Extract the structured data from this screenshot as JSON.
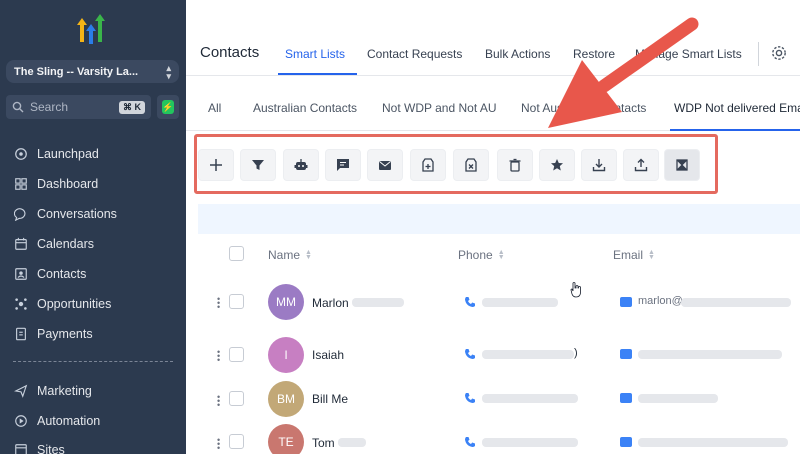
{
  "sidebar": {
    "account_name": "The Sling -- Varsity La...",
    "search_placeholder": "Search",
    "search_shortcut": "⌘ K",
    "items": [
      {
        "label": "Launchpad",
        "icon": "launchpad-icon"
      },
      {
        "label": "Dashboard",
        "icon": "dashboard-icon"
      },
      {
        "label": "Conversations",
        "icon": "chat-icon"
      },
      {
        "label": "Calendars",
        "icon": "calendar-icon"
      },
      {
        "label": "Contacts",
        "icon": "contacts-icon"
      },
      {
        "label": "Opportunities",
        "icon": "opportunities-icon"
      },
      {
        "label": "Payments",
        "icon": "payments-icon"
      },
      {
        "label": "Marketing",
        "icon": "send-icon"
      },
      {
        "label": "Automation",
        "icon": "automation-icon"
      },
      {
        "label": "Sites",
        "icon": "sites-icon"
      }
    ]
  },
  "header": {
    "title": "Contacts",
    "tabs": [
      "Smart Lists",
      "Contact Requests",
      "Bulk Actions",
      "Restore",
      "Manage Smart Lists"
    ],
    "active_tab": "Smart Lists"
  },
  "smart_lists": {
    "tabs": [
      "All",
      "Australian Contacts",
      "Not WDP and Not AU",
      "Not Australian Contacts",
      "WDP Not delivered Ema"
    ],
    "active_tab": "WDP Not delivered Ema"
  },
  "toolbar": {
    "buttons": [
      "add-icon",
      "filter-icon",
      "robot-icon",
      "sms-icon",
      "email-icon",
      "add-tag-icon",
      "remove-tag-icon",
      "delete-icon",
      "star-icon",
      "import-icon",
      "export-icon",
      "merge-icon"
    ]
  },
  "table": {
    "columns": [
      "Name",
      "Phone",
      "Email"
    ],
    "rows": [
      {
        "initials": "MM",
        "name": "Marlon",
        "avatar_color": "#9b7bc4",
        "phone_suffix": "",
        "email": "marlon@"
      },
      {
        "initials": "I",
        "name": "Isaiah",
        "avatar_color": "#c77fc2",
        "phone_suffix": ")",
        "email": ""
      },
      {
        "initials": "BM",
        "name": "Bill Me",
        "avatar_color": "#c2a877",
        "phone_suffix": "",
        "email": ""
      },
      {
        "initials": "TE",
        "name": "Tom",
        "avatar_color": "#c9776f",
        "phone_suffix": "",
        "email": ""
      }
    ]
  },
  "colors": {
    "sidebar_bg": "#2c3a4f",
    "accent": "#2563eb",
    "highlight": "#e46a5f"
  }
}
